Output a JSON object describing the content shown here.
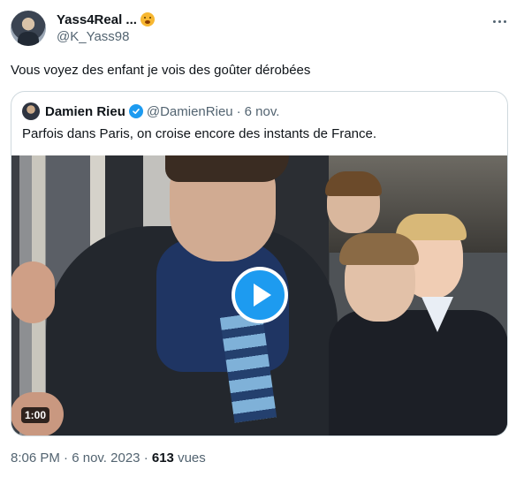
{
  "author": {
    "display_name": "Yass4Real ...",
    "emoji": "yawning-face-emoji",
    "handle": "@K_Yass98"
  },
  "tweet": {
    "text": "Vous voyez des enfant je vois des goûter dérobées"
  },
  "quoted": {
    "name": "Damien Rieu",
    "handle": "@DamienRieu",
    "separator": "·",
    "date": "6 nov.",
    "text": "Parfois dans Paris, on croise encore des instants de France.",
    "video": {
      "duration": "1:00",
      "play_icon": "play-icon"
    }
  },
  "meta": {
    "time": "8:06 PM",
    "separator": "·",
    "date": "6 nov. 2023",
    "separator2": "·",
    "views_count": "613",
    "views_label": "vues"
  },
  "colors": {
    "accent": "#1d9bf0",
    "text": "#0f1419",
    "secondary": "#536471",
    "border": "#cfd9de"
  }
}
